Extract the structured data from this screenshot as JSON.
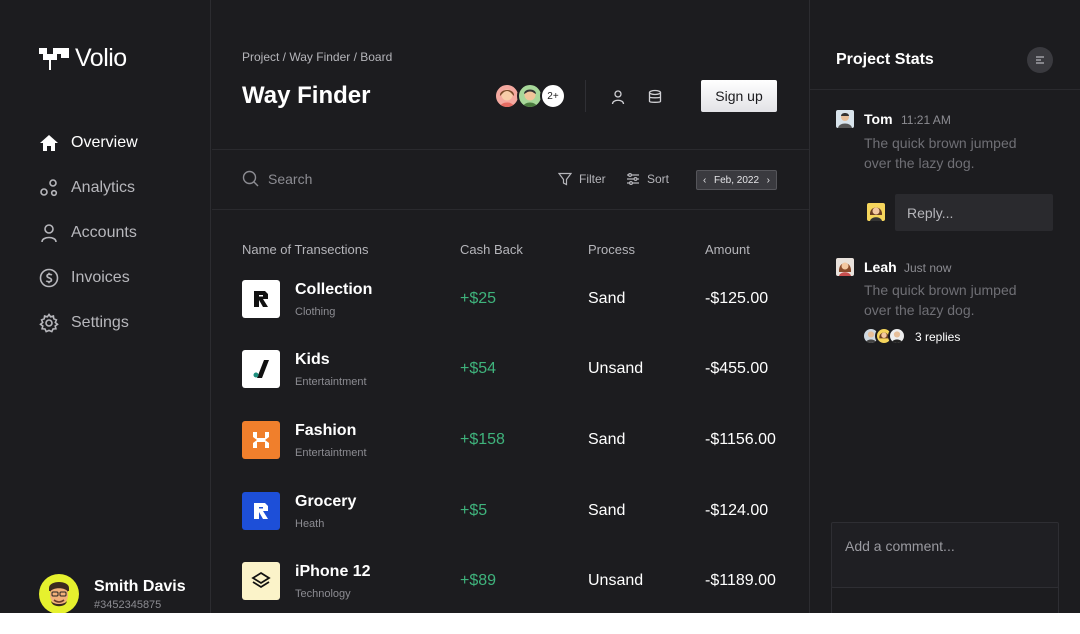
{
  "app": {
    "name": "Volio"
  },
  "sidebar": {
    "items": [
      {
        "label": "Overview",
        "icon": "home-icon",
        "active": true
      },
      {
        "label": "Analytics",
        "icon": "analytics-icon",
        "active": false
      },
      {
        "label": "Accounts",
        "icon": "user-icon",
        "active": false
      },
      {
        "label": "Invoices",
        "icon": "dollar-icon",
        "active": false
      },
      {
        "label": "Settings",
        "icon": "gear-icon",
        "active": false
      }
    ],
    "profile": {
      "name": "Smith Davis",
      "id": "#3452345875"
    }
  },
  "header": {
    "breadcrumb": "Project / Way Finder / Board",
    "title": "Way Finder",
    "avatars_more": "2+",
    "signup_label": "Sign up"
  },
  "toolbar": {
    "search_placeholder": "Search",
    "filter_label": "Filter",
    "sort_label": "Sort",
    "date_label": "Feb, 2022"
  },
  "table": {
    "headers": [
      "Name of Transections",
      "Cash Back",
      "Process",
      "Amount"
    ],
    "rows": [
      {
        "name": "Collection",
        "category": "Clothing",
        "cashback": "+$25",
        "process": "Sand",
        "amount": "-$125.00",
        "logo_bg": "#ffffff",
        "logo_icon": "r-logo-icon"
      },
      {
        "name": "Kids",
        "category": "Entertaintment",
        "cashback": "+$54",
        "process": "Unsand",
        "amount": "-$455.00",
        "logo_bg": "#ffffff",
        "logo_icon": "slash-logo-icon"
      },
      {
        "name": "Fashion",
        "category": "Entertaintment",
        "cashback": "+$158",
        "process": "Sand",
        "amount": "-$1156.00",
        "logo_bg": "#f07f2c",
        "logo_icon": "h-logo-icon"
      },
      {
        "name": "Grocery",
        "category": "Heath",
        "cashback": "+$5",
        "process": "Sand",
        "amount": "-$124.00",
        "logo_bg": "#1d4fd8",
        "logo_icon": "r-logo-icon"
      },
      {
        "name": "iPhone 12",
        "category": "Technology",
        "cashback": "+$89",
        "process": "Unsand",
        "amount": "-$1189.00",
        "logo_bg": "#fbf3c9",
        "logo_icon": "layers-logo-icon"
      }
    ]
  },
  "panel": {
    "title": "Project Stats",
    "comments": [
      {
        "name": "Tom",
        "time": "11:21 AM",
        "text": "The quick brown jumped over the lazy dog."
      },
      {
        "name": "Leah",
        "time": "Just now",
        "text": "The quick brown jumped over the lazy dog."
      }
    ],
    "reply_placeholder": "Reply...",
    "replies_label": "3 replies",
    "comment_placeholder": "Add a comment..."
  },
  "colors": {
    "background": "#1c1c1f",
    "accent_green": "#3fb37c",
    "text_muted": "#8c8c92"
  }
}
